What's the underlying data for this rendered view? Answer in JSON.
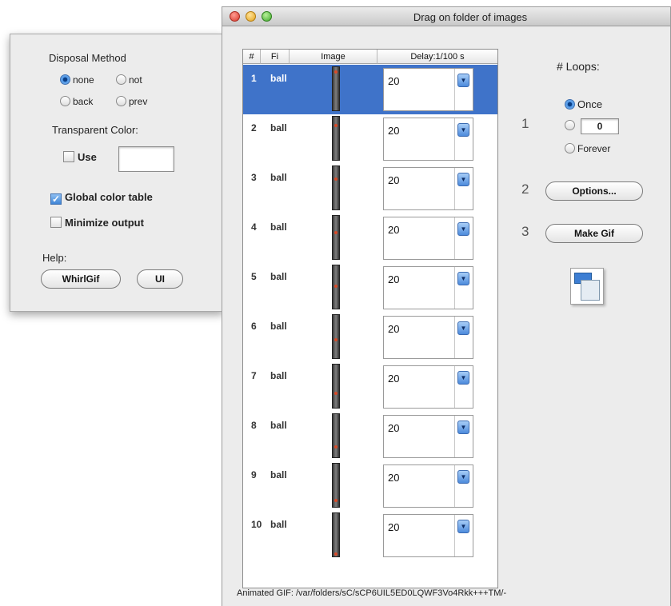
{
  "options_panel": {
    "disposal_label": "Disposal Method",
    "disposal_options": [
      "none",
      "not",
      "back",
      "prev"
    ],
    "disposal_selected": "none",
    "transparent_label": "Transparent Color:",
    "use_label": "Use",
    "use_checked": false,
    "global_table_label": "Global color table",
    "global_table_checked": true,
    "minimize_label": "Minimize output",
    "minimize_checked": false,
    "help_label": "Help:",
    "whirlgif_label": "WhirlGif",
    "ui_label": "UI"
  },
  "window": {
    "title": "Drag on folder of images"
  },
  "table": {
    "headers": [
      "#",
      "Fi",
      "Image",
      "Delay:1/100 s"
    ],
    "rows": [
      {
        "num": "1",
        "file": "ball",
        "delay": "20"
      },
      {
        "num": "2",
        "file": "ball",
        "delay": "20"
      },
      {
        "num": "3",
        "file": "ball",
        "delay": "20"
      },
      {
        "num": "4",
        "file": "ball",
        "delay": "20"
      },
      {
        "num": "5",
        "file": "ball",
        "delay": "20"
      },
      {
        "num": "6",
        "file": "ball",
        "delay": "20"
      },
      {
        "num": "7",
        "file": "ball",
        "delay": "20"
      },
      {
        "num": "8",
        "file": "ball",
        "delay": "20"
      },
      {
        "num": "9",
        "file": "ball",
        "delay": "20"
      },
      {
        "num": "10",
        "file": "ball",
        "delay": "20"
      }
    ],
    "selected_row": 1
  },
  "controls": {
    "step1": "1",
    "step2": "2",
    "step3": "3",
    "loops_label": "# Loops:",
    "loop_once": "Once",
    "loop_count_value": "0",
    "loop_forever": "Forever",
    "loop_selected": "Once",
    "options_button": "Options...",
    "make_gif_button": "Make Gif"
  },
  "status": {
    "text": "Animated GIF: /var/folders/sC/sCP6UIL5ED0LQWF3Vo4Rkk+++TM/-"
  }
}
